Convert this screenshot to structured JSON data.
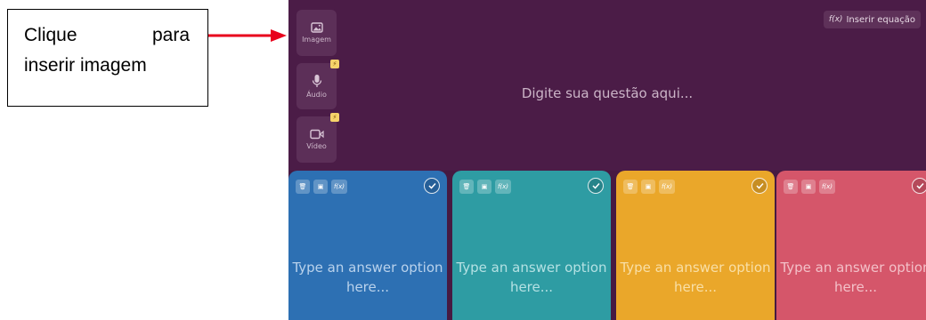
{
  "annotation": {
    "line1_word1": "Clique",
    "line1_word2": "para",
    "line2": "inserir imagem"
  },
  "media_buttons": [
    {
      "label": "Imagem",
      "icon": "image-icon"
    },
    {
      "label": "Áudio",
      "icon": "microphone-icon",
      "badge": "⚡"
    },
    {
      "label": "Vídeo",
      "icon": "video-icon",
      "badge": "⚡"
    }
  ],
  "equation_button": {
    "icon_text": "f(x)",
    "label": "Inserir equação"
  },
  "question_placeholder": "Digite sua questão aqui...",
  "answer_cards": [
    {
      "placeholder": "Type an answer option here...",
      "color": "#2d70b3",
      "text_color": "#b9d2ec"
    },
    {
      "placeholder": "Type an answer option here...",
      "color": "#2e9ca3",
      "text_color": "#b4e1e3"
    },
    {
      "placeholder": "Type an answer option here...",
      "color": "#eaa72a",
      "text_color": "#f9dfa6"
    },
    {
      "placeholder": "Type an answer option here...",
      "color": "#d5566a",
      "text_color": "#f3c0c8"
    }
  ],
  "card_tool_fx": "f(x)",
  "colors": {
    "question_bg": "#4b1c47",
    "annotation_arrow": "#e8001c"
  }
}
